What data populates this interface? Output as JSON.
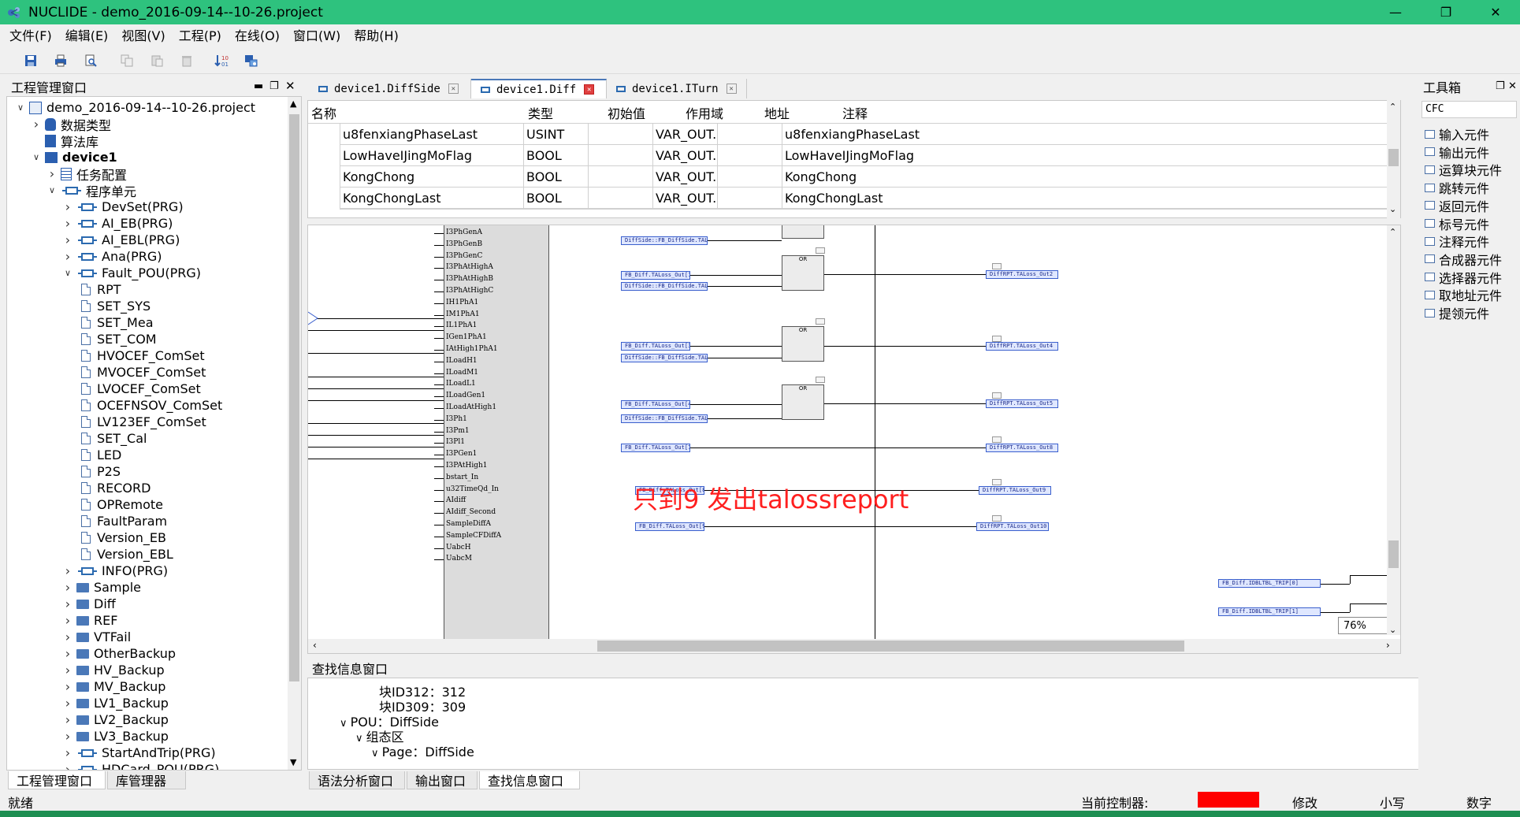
{
  "window": {
    "title": "NUCLIDE - demo_2016-09-14--10-26.project"
  },
  "menu": [
    "文件(F)",
    "编辑(E)",
    "视图(V)",
    "工程(P)",
    "在线(O)",
    "窗口(W)",
    "帮助(H)"
  ],
  "project_panel": {
    "title": "工程管理窗口",
    "tree": [
      {
        "label": "demo_2016-09-14--10-26.project",
        "level": 0,
        "icon": "project",
        "chevron": "down",
        "bold": false
      },
      {
        "label": "数据类型",
        "level": 1,
        "icon": "database",
        "chevron": "right",
        "bold": false
      },
      {
        "label": "算法库",
        "level": 1,
        "icon": "library",
        "chevron": "",
        "bold": false
      },
      {
        "label": "device1",
        "level": 1,
        "icon": "device",
        "chevron": "down",
        "bold": true
      },
      {
        "label": "任务配置",
        "level": 2,
        "icon": "list",
        "chevron": "right",
        "bold": false
      },
      {
        "label": "程序单元",
        "level": 2,
        "icon": "prg",
        "chevron": "down",
        "bold": false
      },
      {
        "label": "DevSet(PRG)",
        "level": 3,
        "icon": "prg",
        "chevron": "right",
        "bold": false
      },
      {
        "label": "AI_EB(PRG)",
        "level": 3,
        "icon": "prg",
        "chevron": "right",
        "bold": false
      },
      {
        "label": "AI_EBL(PRG)",
        "level": 3,
        "icon": "prg",
        "chevron": "right",
        "bold": false
      },
      {
        "label": "Ana(PRG)",
        "level": 3,
        "icon": "prg",
        "chevron": "right",
        "bold": false
      },
      {
        "label": "Fault_POU(PRG)",
        "level": 3,
        "icon": "prg",
        "chevron": "down",
        "bold": false
      },
      {
        "label": "RPT",
        "level": 4,
        "icon": "doc",
        "chevron": "",
        "bold": false
      },
      {
        "label": "SET_SYS",
        "level": 4,
        "icon": "doc",
        "chevron": "",
        "bold": false
      },
      {
        "label": "SET_Mea",
        "level": 4,
        "icon": "doc",
        "chevron": "",
        "bold": false
      },
      {
        "label": "SET_COM",
        "level": 4,
        "icon": "doc",
        "chevron": "",
        "bold": false
      },
      {
        "label": "HVOCEF_ComSet",
        "level": 4,
        "icon": "doc",
        "chevron": "",
        "bold": false
      },
      {
        "label": "MVOCEF_ComSet",
        "level": 4,
        "icon": "doc",
        "chevron": "",
        "bold": false
      },
      {
        "label": "LVOCEF_ComSet",
        "level": 4,
        "icon": "doc",
        "chevron": "",
        "bold": false
      },
      {
        "label": "OCEFNSOV_ComSet",
        "level": 4,
        "icon": "doc",
        "chevron": "",
        "bold": false
      },
      {
        "label": "LV123EF_ComSet",
        "level": 4,
        "icon": "doc",
        "chevron": "",
        "bold": false
      },
      {
        "label": "SET_Cal",
        "level": 4,
        "icon": "doc",
        "chevron": "",
        "bold": false
      },
      {
        "label": "LED",
        "level": 4,
        "icon": "doc",
        "chevron": "",
        "bold": false
      },
      {
        "label": "P2S",
        "level": 4,
        "icon": "doc",
        "chevron": "",
        "bold": false
      },
      {
        "label": "RECORD",
        "level": 4,
        "icon": "doc",
        "chevron": "",
        "bold": false
      },
      {
        "label": "OPRemote",
        "level": 4,
        "icon": "doc",
        "chevron": "",
        "bold": false
      },
      {
        "label": "FaultParam",
        "level": 4,
        "icon": "doc",
        "chevron": "",
        "bold": false
      },
      {
        "label": "Version_EB",
        "level": 4,
        "icon": "doc",
        "chevron": "",
        "bold": false
      },
      {
        "label": "Version_EBL",
        "level": 4,
        "icon": "doc",
        "chevron": "",
        "bold": false
      },
      {
        "label": "INFO(PRG)",
        "level": 3,
        "icon": "prg",
        "chevron": "right",
        "bold": false
      },
      {
        "label": "Sample",
        "level": 3,
        "icon": "folder",
        "chevron": "right",
        "bold": false
      },
      {
        "label": "Diff",
        "level": 3,
        "icon": "folder",
        "chevron": "right",
        "bold": false
      },
      {
        "label": "REF",
        "level": 3,
        "icon": "folder",
        "chevron": "right",
        "bold": false
      },
      {
        "label": "VTFail",
        "level": 3,
        "icon": "folder",
        "chevron": "right",
        "bold": false
      },
      {
        "label": "OtherBackup",
        "level": 3,
        "icon": "folder",
        "chevron": "right",
        "bold": false
      },
      {
        "label": "HV_Backup",
        "level": 3,
        "icon": "folder",
        "chevron": "right",
        "bold": false
      },
      {
        "label": "MV_Backup",
        "level": 3,
        "icon": "folder",
        "chevron": "right",
        "bold": false
      },
      {
        "label": "LV1_Backup",
        "level": 3,
        "icon": "folder",
        "chevron": "right",
        "bold": false
      },
      {
        "label": "LV2_Backup",
        "level": 3,
        "icon": "folder",
        "chevron": "right",
        "bold": false
      },
      {
        "label": "LV3_Backup",
        "level": 3,
        "icon": "folder",
        "chevron": "right",
        "bold": false
      },
      {
        "label": "StartAndTrip(PRG)",
        "level": 3,
        "icon": "prg",
        "chevron": "right",
        "bold": false
      },
      {
        "label": "HDCard_POU(PRG)",
        "level": 3,
        "icon": "prg",
        "chevron": "right",
        "bold": false
      }
    ],
    "bottom_tabs": [
      "工程管理窗口",
      "库管理器"
    ]
  },
  "editor_tabs": [
    {
      "label": "device1.DiffSide",
      "active": false
    },
    {
      "label": "device1.Diff",
      "active": true
    },
    {
      "label": "device1.ITurn",
      "active": false
    }
  ],
  "var_table": {
    "headers": [
      "名称",
      "类型",
      "初始值",
      "作用域",
      "地址",
      "注释"
    ],
    "rows": [
      [
        "u8fenxiangPhaseLast",
        "USINT",
        "",
        "VAR_OUT...",
        "",
        "u8fenxiangPhaseLast"
      ],
      [
        "LowHaveIJingMoFlag",
        "BOOL",
        "",
        "VAR_OUT...",
        "",
        "LowHaveIJingMoFlag"
      ],
      [
        "KongChong",
        "BOOL",
        "",
        "VAR_OUT...",
        "",
        "KongChong"
      ],
      [
        "KongChongLast",
        "BOOL",
        "",
        "VAR_OUT...",
        "",
        "KongChongLast"
      ]
    ]
  },
  "diagram": {
    "block_pins": [
      "I3PhGenA",
      "I3PhGenB",
      "I3PhGenC",
      "I3PhAtHighA",
      "I3PhAtHighB",
      "I3PhAtHighC",
      "IH1PhA1",
      "IM1PhA1",
      "IL1PhA1",
      "IGen1PhA1",
      "IAtHigh1PhA1",
      "ILoadH1",
      "ILoadM1",
      "ILoadL1",
      "ILoadGen1",
      "ILoadAtHigh1",
      "I3Ph1",
      "I3Pm1",
      "I3Pl1",
      "I3PGen1",
      "I3PAtHigh1",
      "bstart_In",
      "u32TimeQd_In",
      "AIdiff",
      "AIdiff_Second",
      "SampleDiffA",
      "SampleCFDiffA",
      "UabcH",
      "UabcM"
    ],
    "or_label": "OR",
    "inputs": [
      "DiffSide::FB_DiffSide.TALo...",
      "FB_Diff.TALoss_Out[1]",
      "DiffSide::FB_DiffSide.TALo...",
      "FB_Diff.TALoss_Out[3]",
      "DiffSide::FB_DiffSide.TALo...",
      "FB_Diff.TALoss_Out[4]",
      "DiffSide::FB_DiffSide.TALo...",
      "FB_Diff.TALoss_Out[7]",
      "FB_Diff.TALoss_Out[8]",
      "FB_Diff.TALoss_Out[9]"
    ],
    "outputs": [
      "DiffRPT.TALoss_Out2",
      "DiffRPT.TALoss_Out4",
      "DiffRPT.TALoss_Out5",
      "DiffRPT.TALoss_Out8",
      "DiffRPT.TALoss_Out9",
      "DiffRPT.TALoss_Out10"
    ],
    "trip_tags": [
      "FB_Diff.IDBLTBL_TRIP[0]",
      "FB_Diff.IDBLTBL_TRIP[1]"
    ],
    "annotation": "只到9 发出talossreport",
    "annotation_color": "#ff1f1f",
    "zoom": "76%"
  },
  "search_panel": {
    "title": "查找信息窗口",
    "lines": [
      {
        "text": "块ID312：312",
        "indent": 3,
        "chevron": ""
      },
      {
        "text": "块ID309：309",
        "indent": 3,
        "chevron": ""
      },
      {
        "text": "POU：DiffSide",
        "indent": 1,
        "chevron": "down"
      },
      {
        "text": "组态区",
        "indent": 2,
        "chevron": "down"
      },
      {
        "text": "Page：DiffSide",
        "indent": 3,
        "chevron": "down"
      }
    ],
    "bottom_tabs": [
      "语法分析窗口",
      "输出窗口",
      "查找信息窗口"
    ]
  },
  "toolbox": {
    "title": "工具箱",
    "category": "CFC",
    "items": [
      "输入元件",
      "输出元件",
      "运算块元件",
      "跳转元件",
      "返回元件",
      "标号元件",
      "注释元件",
      "合成器元件",
      "选择器元件",
      "取地址元件",
      "提领元件"
    ]
  },
  "status": {
    "left": "就绪",
    "controller_label": "当前控制器:",
    "controller_color": "#ff0000",
    "mode": "修改",
    "case": "小写",
    "numlock": "数字"
  }
}
